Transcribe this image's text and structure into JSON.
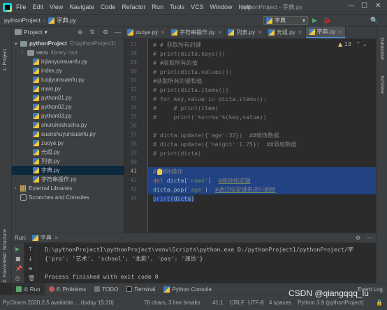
{
  "menu": [
    "File",
    "Edit",
    "View",
    "Navigate",
    "Code",
    "Refactor",
    "Run",
    "Tools",
    "VCS",
    "Window",
    "Help"
  ],
  "window_title": "pythonProject - 字典.py",
  "window_controls": {
    "minimize": "—",
    "maximize": "☐",
    "close": "✕"
  },
  "breadcrumb": {
    "project": "pythonProject",
    "separator": "›",
    "file": "字典.py"
  },
  "run_config": {
    "label": "字典",
    "dropdown": "▾"
  },
  "nav_tools": {
    "run": "▶",
    "debug": "🐞",
    "search": "🔍"
  },
  "left_strip": {
    "project": "1: Project",
    "structure": "Z: Structure",
    "favorites": "2: Favorites"
  },
  "right_strip": {
    "database": "Database",
    "sciview": "SciView"
  },
  "project_panel": {
    "title": "Project",
    "title_arrow": "▾",
    "icons": {
      "target": "⊕",
      "collapse": "⇅",
      "settings": "⚙",
      "hide": "—"
    },
    "tree": [
      {
        "label": "pythonProject",
        "hint": "D:\\pythonProject1\\",
        "arrow": "▾"
      },
      {
        "label": "venv",
        "hint": "library root",
        "arrow": "›"
      },
      {
        "label": "bijiaoyunsuanfu.py"
      },
      {
        "label": "index.py"
      },
      {
        "label": "luojiyunsuanfu.py"
      },
      {
        "label": "main.py"
      },
      {
        "label": "python01.py"
      },
      {
        "label": "python02.py"
      },
      {
        "label": "python03.py"
      },
      {
        "label": "shuruheshuchu.py"
      },
      {
        "label": "suanshuyunsuanfu.py"
      },
      {
        "label": "zuoye.py"
      },
      {
        "label": "元组.py"
      },
      {
        "label": "列表.py"
      },
      {
        "label": "字典.py"
      },
      {
        "label": "字符串操作.py"
      },
      {
        "label": "External Libraries",
        "arrow": "›"
      },
      {
        "label": "Scratches and Consoles"
      }
    ]
  },
  "editor_tabs": [
    "zuoye.py",
    "字符串操作.py",
    "列表.py",
    "元组.py",
    "字典.py"
  ],
  "tab_close": "✕",
  "warnings": {
    "icon": "▲",
    "count": "13",
    "up": "⌃",
    "down": "⌄"
  },
  "line_numbers": [
    "27",
    "28",
    "29",
    "30",
    "31",
    "32",
    "33",
    "34",
    "35",
    "36",
    "37",
    "38",
    "39",
    "40",
    "41",
    "42",
    "43",
    "44"
  ],
  "code": {
    "l27": "# # 获取所有的键",
    "l28": "# print(dicta.keys())",
    "l29": "# #获取所有的值",
    "l30": "# print(dicta.values())",
    "l31": "#获取所有的键和值",
    "l32": "# print(dicta.items())",
    "l33": "# for key,value in dicta.items():",
    "l34": "#     # print(item)",
    "l35": "#     print('%s==%s'%(key,value))",
    "l37": "# dicta.update({'age':32})  ##修改数据",
    "l38": "# dicta.update({'height':1.75})  ##添加数据",
    "l39": "# print(dicta)",
    "l41": "# 删除操作",
    "l42_kw": "del ",
    "l42_a": "dicta[",
    "l42_str": "'name'",
    "l42_b": "]  ",
    "l42_cm": "#删除指定键",
    "l43_a": "dicta.pop(",
    "l43_str": "'age'",
    "l43_b": ")  ",
    "l43_cm": "#通过指定键来进行删除",
    "l44_fn": "print",
    "l44_rest": "(dicta)"
  },
  "run_panel": {
    "label": "Run:",
    "tab": "字典",
    "tab_close": "✕",
    "settings_icon": "⚙",
    "hide_icon": "—",
    "buttons": {
      "rerun": "▶",
      "up": "↑",
      "stop": "■",
      "down": "↓",
      "wrap": "≡",
      "pin": "📌",
      "print": "⎙",
      "trash": "🗑"
    },
    "output": [
      "D:\\pythonProject1\\pythonProject\\venv\\Scripts\\python.exe D:/pythonProject1/pythonProject/字",
      "{'pro': '艺术', 'school': '北影', 'pos': '演员'}",
      "",
      "Process finished with exit code 0"
    ]
  },
  "tool_tabs": [
    "4: Run",
    "6: Problems",
    "TODO",
    "Terminal",
    "Python Console",
    "Event Log"
  ],
  "status": {
    "left": "PyCharm 2020.2.5 available ... (today 15:20)",
    "chars": "76 chars, 3 line breaks",
    "pos": "41:1",
    "crlf": "CRLF",
    "enc": "UTF-8",
    "indent": "4 spaces",
    "python": "Python 3.9 (pythonProject)",
    "lock": "🔒"
  },
  "watermark": "CSDN @qiangqqq_lu"
}
